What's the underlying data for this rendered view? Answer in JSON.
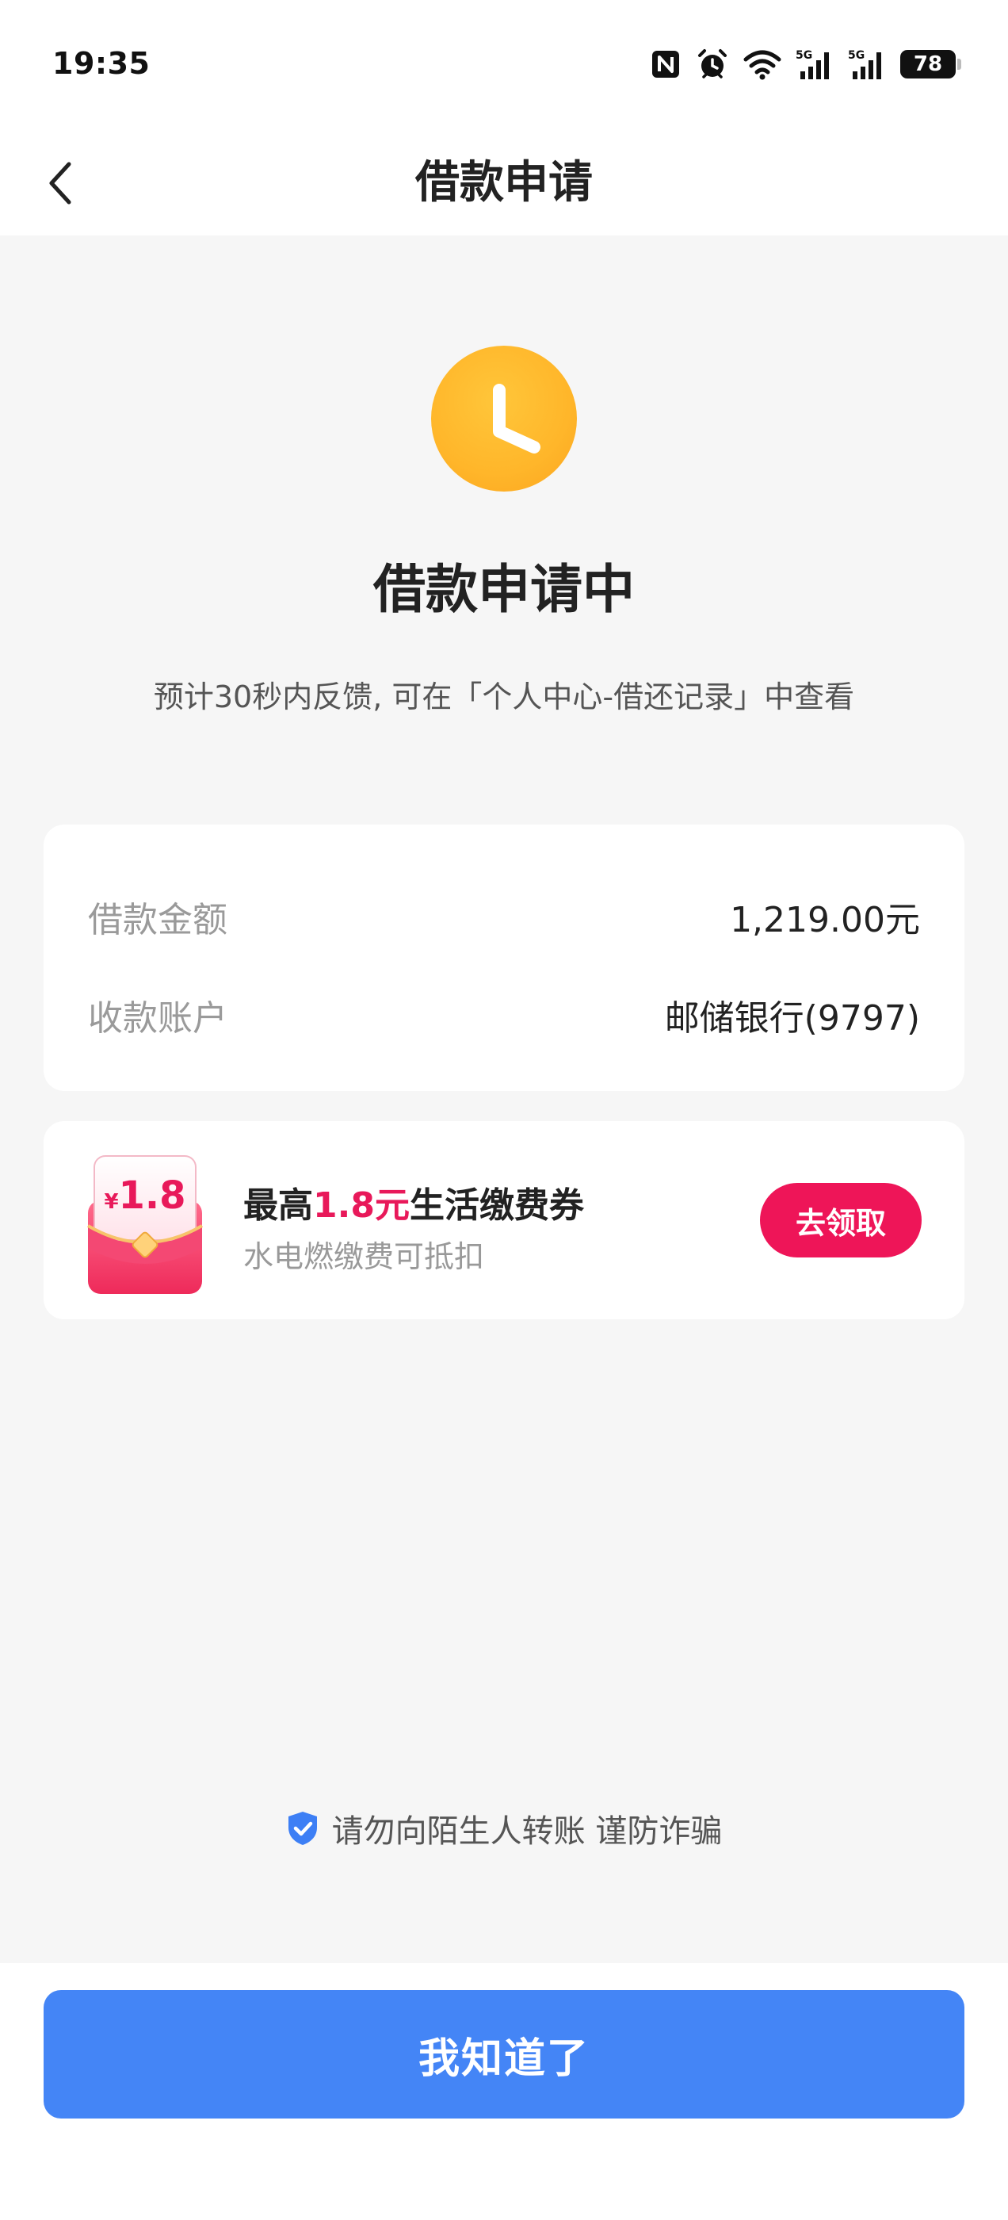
{
  "status_bar": {
    "time": "19:35",
    "battery": "78",
    "icons": [
      "nfc-icon",
      "alarm-icon",
      "wifi-icon",
      "5g-signal-icon",
      "5g-signal-icon",
      "battery-icon"
    ]
  },
  "header": {
    "title": "借款申请",
    "back_icon": "chevron-left-icon"
  },
  "status": {
    "icon": "clock-icon",
    "title": "借款申请中",
    "subtitle": "预计30秒内反馈, 可在「个人中心-借还记录」中查看",
    "icon_color": "#FFB62A"
  },
  "loan_info": {
    "amount_label": "借款金额",
    "amount_value": "1,219.00元",
    "account_label": "收款账户",
    "account_value": "邮储银行(9797)"
  },
  "promo": {
    "coupon_amount": "1.8",
    "coupon_currency": "¥",
    "title_prefix": "最高",
    "title_highlight": "1.8元",
    "title_suffix": "生活缴费券",
    "subtitle": "水电燃缴费可抵扣",
    "button_label": "去领取",
    "accent_color": "#EE1558"
  },
  "notice": {
    "icon": "shield-check-icon",
    "text": "请勿向陌生人转账 谨防诈骗"
  },
  "footer": {
    "confirm_label": "我知道了",
    "button_color": "#4485F6"
  }
}
